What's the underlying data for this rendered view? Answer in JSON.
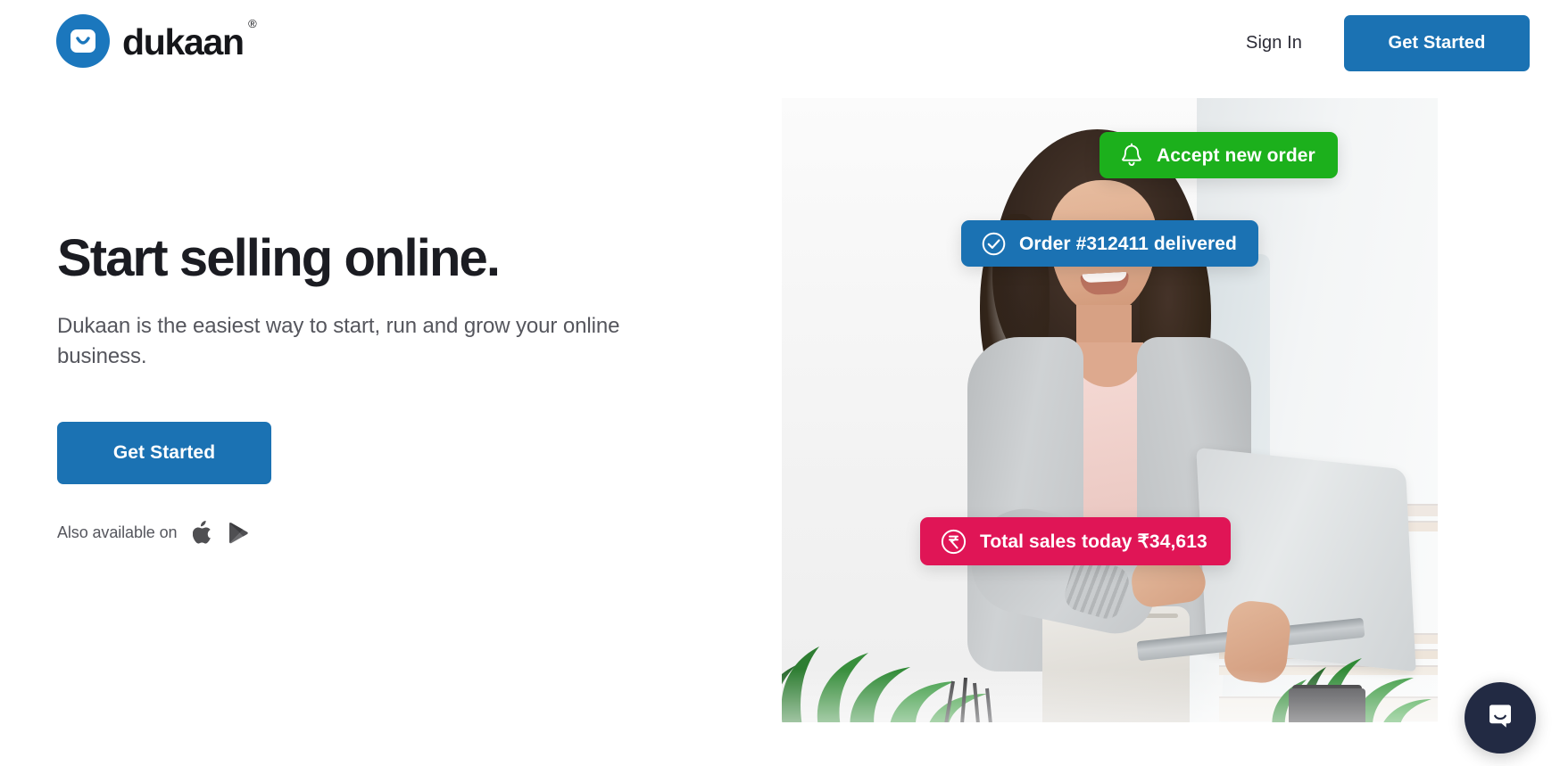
{
  "header": {
    "logo": {
      "mark_icon": "dukaan-bag-smile-icon",
      "wordmark": "dukaan",
      "registered_mark": "®",
      "brand_color": "#1b77bd"
    },
    "sign_in_label": "Sign In",
    "cta_label": "Get Started",
    "cta_color": "#1b72b3"
  },
  "hero": {
    "title": "Start selling online.",
    "subtitle": "Dukaan is the easiest way to start, run and grow your online business.",
    "cta_label": "Get Started",
    "also_available_label": "Also available on",
    "store_icons": [
      {
        "name": "apple-app-store-icon",
        "label": "Apple App Store"
      },
      {
        "name": "google-play-store-icon",
        "label": "Google Play Store"
      }
    ]
  },
  "hero_media": {
    "background_color": "#f1f2f2",
    "photo_description": "Smiling woman with curly dark hair in a grey cardigan over a pink top, holding an open silver laptop, with green potted plants in a bright white room",
    "badges": [
      {
        "id": "accept-new-order",
        "label": "Accept new order",
        "icon": "bell-icon",
        "color": "#1cb01c"
      },
      {
        "id": "order-delivered",
        "label": "Order #312411 delivered",
        "icon": "check-circle-icon",
        "color": "#1b72b3"
      },
      {
        "id": "total-sales-today",
        "label": "Total sales today ₹34,613",
        "icon": "rupee-circle-icon",
        "color": "#e01556"
      }
    ]
  },
  "chat": {
    "launcher_icon": "chat-bubble-smile-icon",
    "launcher_color": "#222a43"
  }
}
